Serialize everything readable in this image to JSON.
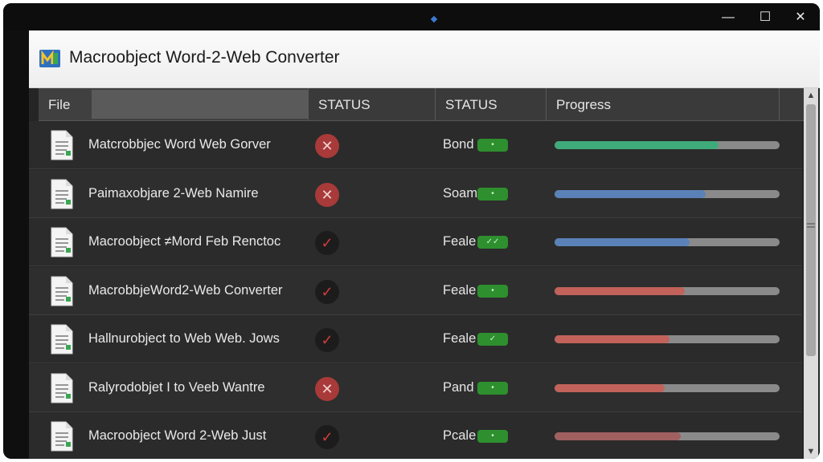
{
  "window": {
    "title": "Macroobject Word-2-Web Converter",
    "controls": {
      "minimize": "—",
      "maximize": "☐",
      "close": "✕"
    }
  },
  "columns": [
    {
      "key": "file",
      "label": "File"
    },
    {
      "key": "status",
      "label": "STATUS"
    },
    {
      "key": "status2",
      "label": "STATUS"
    },
    {
      "key": "progress",
      "label": "Progress"
    }
  ],
  "rows": [
    {
      "name": "Matcrobbjec Word Web Gorver",
      "status": "error",
      "state": "Bond",
      "pill": "•",
      "progress": 0.73,
      "color": "#3faa7a"
    },
    {
      "name": "Paimaxobjare 2-Web Namire",
      "status": "error",
      "state": "Soam",
      "pill": "•",
      "progress": 0.67,
      "color": "#5a82b8"
    },
    {
      "name": "Macroobject ≠Mord Feb Renctoc",
      "status": "ok",
      "state": "Feale",
      "pill": "✓✓",
      "progress": 0.6,
      "color": "#5a82b8"
    },
    {
      "name": "MacrobbjeWord2-Web Converter",
      "status": "ok",
      "state": "Feale",
      "pill": "•",
      "progress": 0.58,
      "color": "#c2625a"
    },
    {
      "name": "Hallnurobject to Web Web. Jows",
      "status": "ok",
      "state": "Feale",
      "pill": "✓",
      "progress": 0.51,
      "color": "#c2625a"
    },
    {
      "name": "Ralyrodobjet I to Veeb Wantre",
      "status": "error",
      "state": "Pand",
      "pill": "•",
      "progress": 0.49,
      "color": "#c2625a"
    },
    {
      "name": "Macroobject Word 2-Web Just",
      "status": "ok",
      "state": "Pcale",
      "pill": "•",
      "progress": 0.56,
      "color": "#a06060"
    }
  ]
}
